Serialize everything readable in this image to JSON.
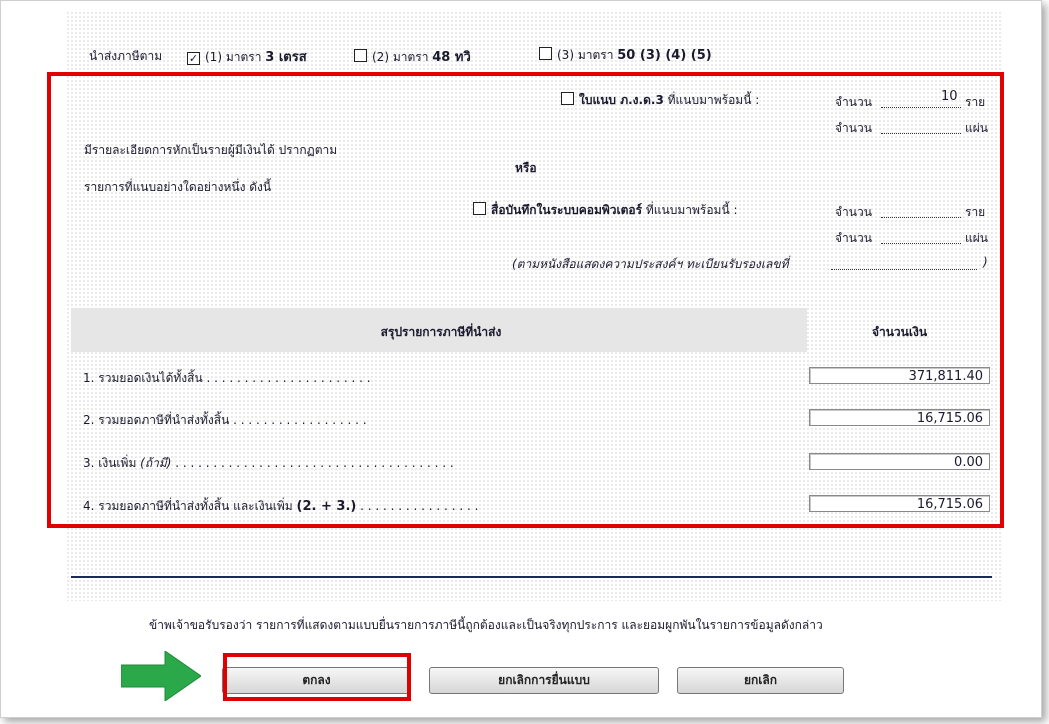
{
  "header_row": {
    "prefix": "นำส่งภาษีตาม",
    "options": [
      {
        "checked": true,
        "mark": "✓",
        "text": "(1) มาตรา ",
        "bold": "3 เตรส"
      },
      {
        "checked": false,
        "mark": "",
        "text": "(2) มาตรา ",
        "bold": "48 ทวิ"
      },
      {
        "checked": false,
        "mark": "",
        "text": "(3) มาตรา ",
        "bold": "50 (3) (4) (5)"
      }
    ]
  },
  "attachment": {
    "intro_line1": "มีรายละเอียดการหักเป็นรายผู้มีเงินได้ ปรากฏตาม",
    "intro_line2": "รายการที่แนบอย่างใดอย่างหนึ่ง ดังนี้",
    "option1_bold": "ใบแนบ ภ.ง.ด.3",
    "option1_rest": " ที่แนบมาพร้อมนี้ :",
    "or": "หรือ",
    "option2_bold": "สื่อบันทึกในระบบคอมพิวเตอร์",
    "option2_rest": " ที่แนบมาพร้อมนี้ :",
    "count_label": "จำนวน",
    "unit_persons": "ราย",
    "unit_sheets": "แผ่น",
    "option1_persons_value": "10",
    "note": "(ตามหนังสือแสดงความประสงค์ฯ ทะเบียนรับรองเลขที่",
    "note_close": ")"
  },
  "summary": {
    "header_title": "สรุปรายการภาษีที่นำส่ง",
    "header_amount": "จำนวนเงิน",
    "rows": [
      {
        "label": "1. รวมยอดเงินได้ทั้งสิ้น",
        "italic": "",
        "bold": "",
        "dots": " . . . . . . . . . . . . . . . . . . . . . .",
        "value": "371,811.40"
      },
      {
        "label": "2. รวมยอดภาษีที่นำส่งทั้งสิ้น",
        "italic": "",
        "bold": "",
        "dots": " . . . . . . . . . . . . . . . . . .",
        "value": "16,715.06"
      },
      {
        "label": "3. เงินเพิ่ม ",
        "italic": "(ถ้ามี)",
        "bold": "",
        "dots": " . . . . . . . . . . . . . . . . . . . . . . . . . . . . . . . . . . . . .",
        "value": "0.00"
      },
      {
        "label": "4. รวมยอดภาษีที่นำส่งทั้งสิ้น และเงินเพิ่ม ",
        "italic": "",
        "bold": "(2. + 3.)",
        "dots": " . . . . . . . . . . . . . . . .",
        "value": "16,715.06"
      }
    ]
  },
  "certify_text": "ข้าพเจ้าขอรับรองว่า รายการที่แสดงตามแบบยื่นรายการภาษีนี้ถูกต้องและเป็นจริงทุกประการ และยอมผูกพันในรายการข้อมูลดังกล่าว",
  "buttons": {
    "ok": "ตกลง",
    "cancel_filing": "ยกเลิกการยื่นแบบ",
    "cancel": "ยกเลิก"
  },
  "colors": {
    "highlight": "#e00000",
    "arrow": "#2aa84a",
    "rule": "#1c2a5a"
  }
}
